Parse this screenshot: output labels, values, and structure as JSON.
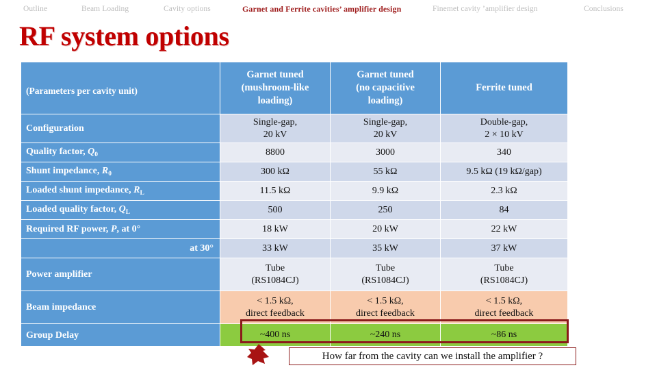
{
  "nav": {
    "items": [
      {
        "label": "Outline",
        "active": false
      },
      {
        "label": "Beam Loading",
        "active": false
      },
      {
        "label": "Cavity options",
        "active": false
      },
      {
        "label": "Garnet and Ferrite cavities’ amplifier design",
        "active": true
      },
      {
        "label": "Finemet cavity ’amplifier design",
        "active": false
      },
      {
        "label": "Conclusions",
        "active": false
      }
    ],
    "active_color": "#9E1B1B",
    "inactive_color": "#BDBDBD"
  },
  "title": "RF system options",
  "title_color": "#C00000",
  "table": {
    "header": {
      "label": "(Parameters per cavity unit)",
      "columns": [
        "Garnet tuned\n(mushroom-like loading)",
        "Garnet tuned\n(no capacitive loading)",
        "Ferrite tuned"
      ],
      "col1_line1": "Garnet tuned",
      "col1_line2": "(mushroom-like",
      "col1_line3": "loading)",
      "col2_line1": "Garnet tuned",
      "col2_line2": "(no capacitive",
      "col2_line3": "loading)",
      "col3_line1": "Ferrite tuned",
      "background": "#5B9BD5",
      "text_color": "#FFFFFF"
    },
    "rows": [
      {
        "label_html": "Configuration",
        "label_plain": "Configuration",
        "values": [
          "Single-gap,\n20 kV",
          "Single-gap,\n20 kV",
          "Double-gap,\n2 × 10 kV"
        ],
        "v0_l1": "Single-gap,",
        "v0_l2": "20 kV",
        "v1_l1": "Single-gap,",
        "v1_l2": "20 kV",
        "v2_l1": "Double-gap,",
        "v2_l2": "2 × 10 kV"
      },
      {
        "label_plain": "Quality factor, Q0",
        "label_main": "Quality factor, ",
        "label_sym": "Q",
        "label_sub": "0",
        "values": [
          "8800",
          "3000",
          "340"
        ]
      },
      {
        "label_plain": "Shunt impedance, R0",
        "label_main": "Shunt impedance, ",
        "label_sym": "R",
        "label_sub": "0",
        "values": [
          "300 kΩ",
          "55 kΩ",
          "9.5 kΩ (19 kΩ/gap)"
        ]
      },
      {
        "label_plain": "Loaded shunt impedance, RL",
        "label_main": "Loaded shunt impedance, ",
        "label_sym": "R",
        "label_sub": "L",
        "values": [
          "11.5 kΩ",
          "9.9 kΩ",
          "2.3 kΩ"
        ]
      },
      {
        "label_plain": "Loaded quality factor, QL",
        "label_main": "Loaded quality factor, ",
        "label_sym": "Q",
        "label_sub": "L",
        "values": [
          "500",
          "250",
          "84"
        ]
      },
      {
        "label_plain": "Required RF power, P, at 0°",
        "label_main": "Required RF power, ",
        "label_sym": "P",
        "label_tail": ", at 0°",
        "values": [
          "18 kW",
          "20 kW",
          "22 kW"
        ]
      },
      {
        "label_plain": "at 30°",
        "label_main": "at 30°",
        "align": "right",
        "values": [
          "33 kW",
          "35 kW",
          "37 kW"
        ]
      },
      {
        "label_plain": "Power amplifier",
        "label_main": "Power amplifier",
        "values": [
          "Tube\n(RS1084CJ)",
          "Tube\n(RS1084CJ)",
          "Tube\n(RS1084CJ)"
        ],
        "v0_l1": "Tube",
        "v0_l2": "(RS1084CJ)",
        "v1_l1": "Tube",
        "v1_l2": "(RS1084CJ)",
        "v2_l1": "Tube",
        "v2_l2": "(RS1084CJ)"
      },
      {
        "label_plain": "Beam impedance",
        "label_main": "Beam impedance",
        "values": [
          "< 1.5 kΩ,\ndirect feedback",
          "< 1.5 kΩ,\ndirect feedback",
          "< 1.5 kΩ,\ndirect feedback"
        ],
        "v0_l1": "< 1.5 kΩ,",
        "v0_l2": "direct feedback",
        "v1_l1": "< 1.5 kΩ,",
        "v1_l2": "direct feedback",
        "v2_l1": "< 1.5 kΩ,",
        "v2_l2": "direct feedback",
        "highlight": "#F8CBAD"
      },
      {
        "label_plain": "Group Delay",
        "label_main": "Group Delay",
        "values": [
          "~400 ns",
          "~240 ns",
          "~86 ns"
        ],
        "highlight": "#8CCB40"
      }
    ],
    "band_light": "#E8EBF3",
    "band_dark": "#CFD8EA"
  },
  "callout": {
    "text": "How far from the cavity can we install the amplifier ?",
    "border_color": "#8B1A1A",
    "arrow_color": "#A81414"
  },
  "highlight_border_color": "#8B1A1A"
}
